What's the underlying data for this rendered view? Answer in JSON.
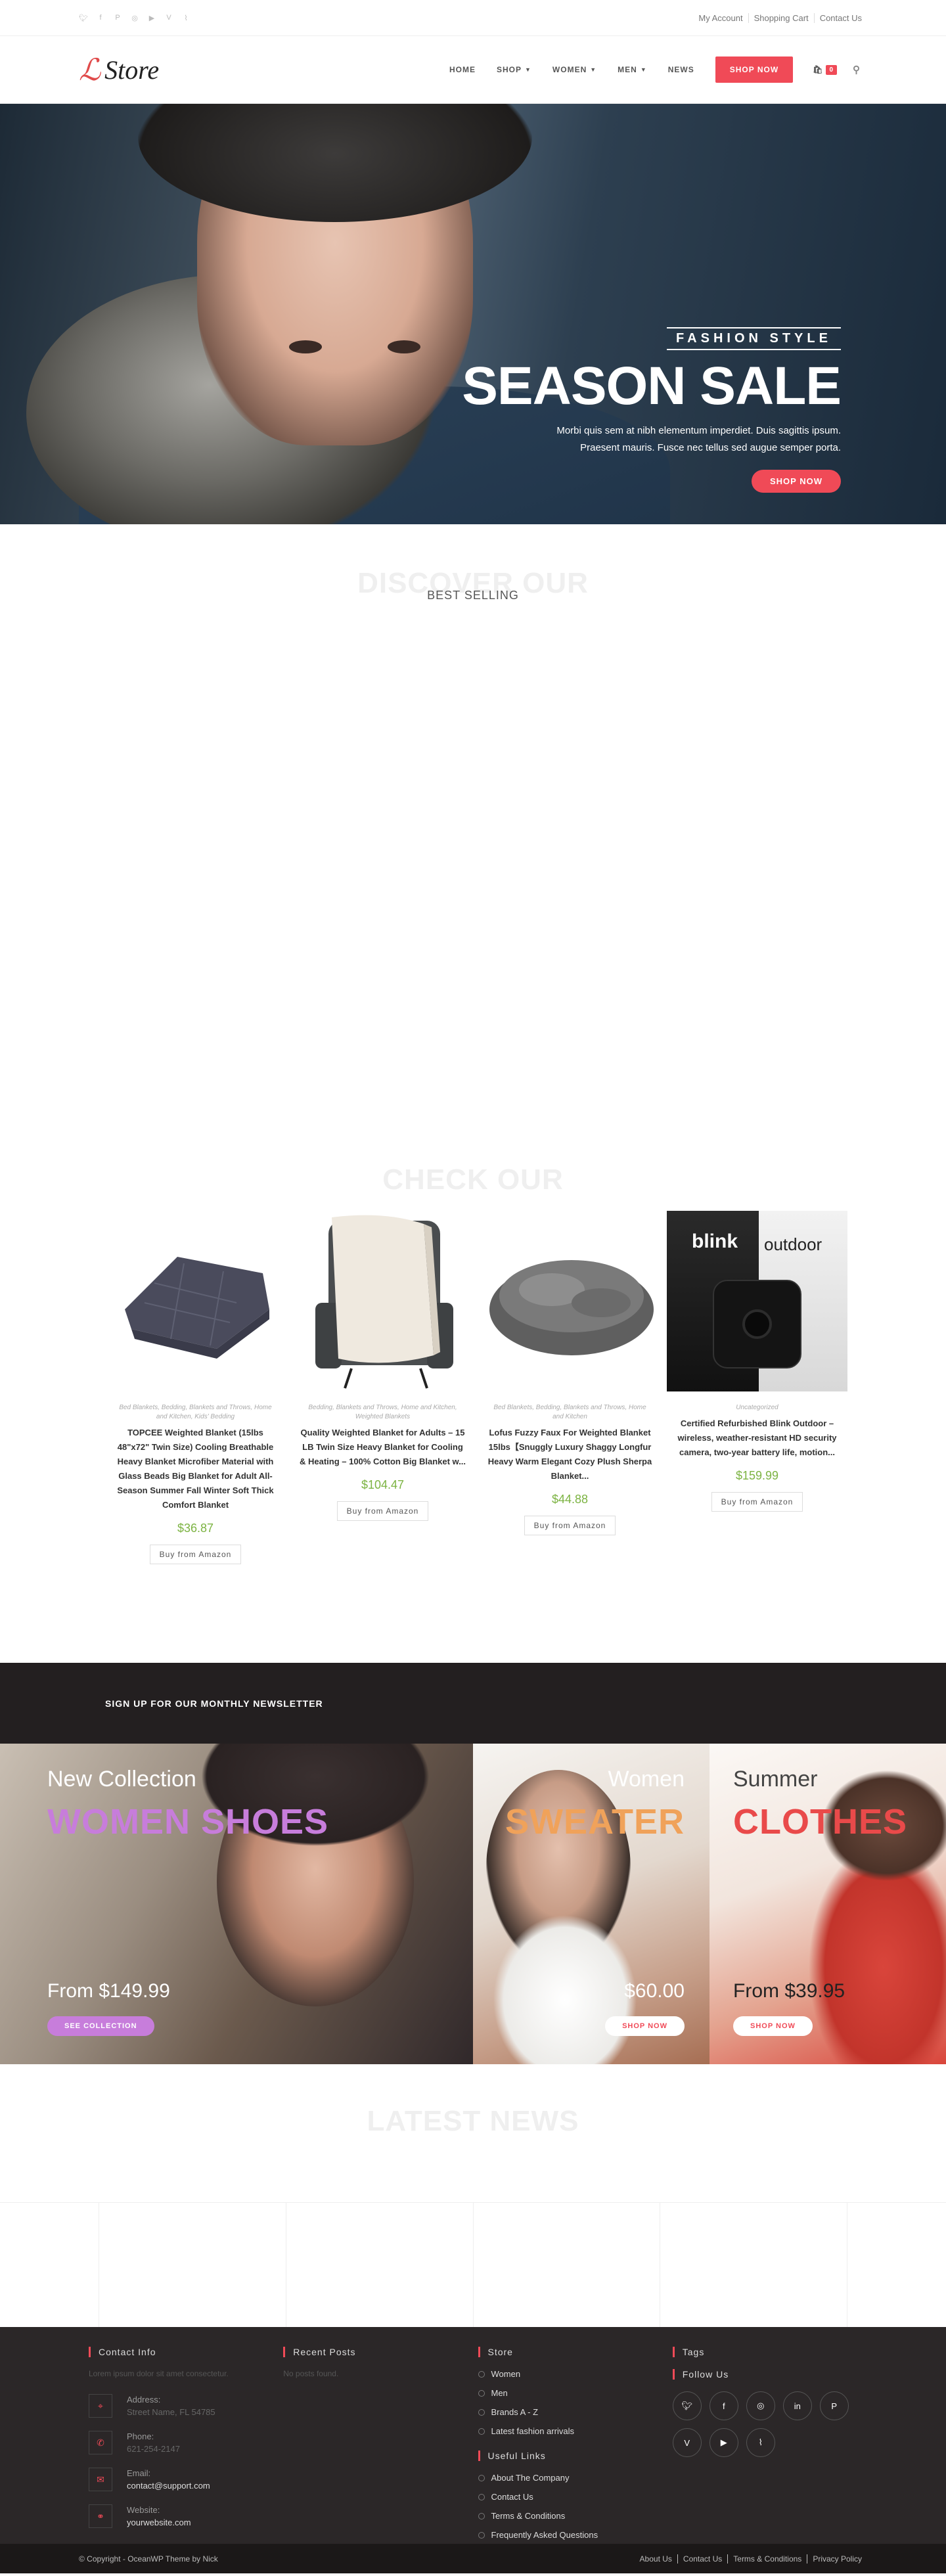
{
  "topbar": {
    "social_icons": [
      "twitter-icon",
      "facebook-icon",
      "pinterest-icon",
      "instagram-icon",
      "youtube-icon",
      "vine-icon",
      "rss-icon"
    ],
    "links": [
      "My Account",
      "Shopping Cart",
      "Contact Us"
    ]
  },
  "header": {
    "logo_text": "Store",
    "nav": [
      {
        "label": "HOME",
        "has_dropdown": false
      },
      {
        "label": "SHOP",
        "has_dropdown": true
      },
      {
        "label": "WOMEN",
        "has_dropdown": true
      },
      {
        "label": "MEN",
        "has_dropdown": true
      },
      {
        "label": "NEWS",
        "has_dropdown": false
      }
    ],
    "shop_now": "SHOP NOW",
    "cart_count": "0",
    "accent": "#f04a57"
  },
  "hero": {
    "kicker": "FASHION STYLE",
    "title": "SEASON SALE",
    "desc_line1": "Morbi quis sem at nibh elementum imperdiet. Duis sagittis ipsum.",
    "desc_line2": "Praesent mauris. Fusce nec tellus sed augue semper porta.",
    "cta": "SHOP NOW"
  },
  "discover": {
    "ghost": "DISCOVER OUR",
    "subtitle": "BEST SELLING"
  },
  "check": {
    "ghost": "CHECK OUR",
    "products": [
      {
        "category": "Bed Blankets, Bedding, Blankets and Throws, Home and Kitchen, Kids' Bedding",
        "name": "TOPCEE Weighted Blanket (15lbs 48\"x72\" Twin Size) Cooling Breathable Heavy Blanket Microfiber Material with Glass Beads Big Blanket for Adult All-Season Summer Fall Winter Soft Thick Comfort Blanket",
        "price": "$36.87",
        "button": "Buy from Amazon"
      },
      {
        "category": "Bedding, Blankets and Throws, Home and Kitchen, Weighted Blankets",
        "name": "Quality Weighted Blanket for Adults – 15 LB Twin Size Heavy Blanket for Cooling & Heating – 100% Cotton Big Blanket w...",
        "price": "$104.47",
        "button": "Buy from Amazon"
      },
      {
        "category": "Bed Blankets, Bedding, Blankets and Throws, Home and Kitchen",
        "name": "Lofus Fuzzy Faux For Weighted Blanket 15lbs【Snuggly Luxury Shaggy Longfur Heavy Warm Elegant Cozy Plush Sherpa Blanket...",
        "price": "$44.88",
        "button": "Buy from Amazon"
      },
      {
        "category": "Uncategorized",
        "name": "Certified Refurbished Blink Outdoor – wireless, weather-resistant HD security camera, two-year battery life, motion...",
        "price": "$159.99",
        "button": "Buy from Amazon",
        "image_text": "blink",
        "image_text2": "outdoor"
      }
    ]
  },
  "newsletter": {
    "title": "SIGN UP FOR OUR MONTHLY NEWSLETTER"
  },
  "banners": [
    {
      "label": "New Collection",
      "big": "WOMEN SHOES",
      "from": "From $149.99",
      "button": "SEE COLLECTION",
      "big_color": "#c77ddb"
    },
    {
      "label": "Women",
      "big": "SWEATER",
      "from": "$60.00",
      "button": "SHOP NOW",
      "big_color": "#f0a25a"
    },
    {
      "label": "Summer",
      "big": "CLOTHES",
      "from": "From $39.95",
      "button": "SHOP NOW",
      "big_color": "#e94a4a"
    }
  ],
  "latest": {
    "ghost": "LATEST NEWS"
  },
  "footer": {
    "contact": {
      "title": "Contact Info",
      "intro": "Lorem ipsum dolor sit amet consectetur.",
      "items": [
        {
          "label": "Address:",
          "value": "Street Name, FL 54785"
        },
        {
          "label": "Phone:",
          "value": "621-254-2147"
        },
        {
          "label": "Email:",
          "value": "contact@support.com"
        },
        {
          "label": "Website:",
          "value": "yourwebsite.com"
        }
      ]
    },
    "recent": {
      "title": "Recent Posts",
      "empty": "No posts found."
    },
    "store": {
      "title": "Store",
      "items": [
        "Women",
        "Men",
        "Brands A - Z",
        "Latest fashion arrivals"
      ],
      "useful_title": "Useful Links",
      "useful": [
        "About The Company",
        "Contact Us",
        "Terms & Conditions",
        "Frequently Asked Questions"
      ]
    },
    "tags": {
      "title": "Tags",
      "follow": "Follow Us",
      "icons": [
        "twitter-icon",
        "facebook-icon",
        "instagram-icon",
        "linkedin-icon",
        "pinterest-icon",
        "vine-icon",
        "youtube-icon",
        "rss-icon"
      ]
    }
  },
  "bottom": {
    "copyright": "© Copyright - OceanWP Theme by Nick",
    "links": [
      "About Us",
      "Contact Us",
      "Terms & Conditions",
      "Privacy Policy"
    ]
  }
}
